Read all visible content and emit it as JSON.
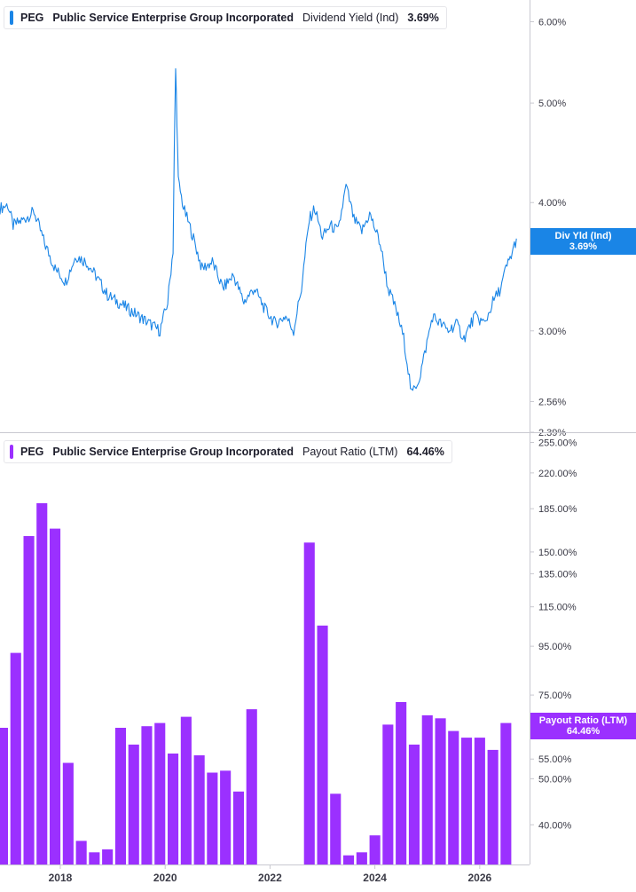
{
  "colors": {
    "yield": "#1a85e6",
    "payout": "#9b30ff",
    "axis": "#c9c9d0",
    "text": "#3a3a46"
  },
  "x_axis_ticks": [
    "2018",
    "2020",
    "2022",
    "2024",
    "2026"
  ],
  "panels": {
    "yield": {
      "ticker": "PEG",
      "company": "Public Service Enterprise Group Incorporated",
      "metric": "Dividend Yield (Ind)",
      "value": "3.69%",
      "badge_label": "Div Yld (Ind)",
      "badge_value": "3.69%"
    },
    "payout": {
      "ticker": "PEG",
      "company": "Public Service Enterprise Group Incorporated",
      "metric": "Payout Ratio (LTM)",
      "value": "64.46%",
      "badge_label": "Payout Ratio (LTM)",
      "badge_value": "64.46%"
    }
  },
  "chart_data": [
    {
      "type": "line",
      "series": [
        {
          "name": "Dividend Yield (Ind)"
        }
      ],
      "scale": "log",
      "ylim": [
        2.39,
        6.3
      ],
      "xlim": [
        2016.85,
        2026.95
      ],
      "y_tick_labels": [
        "6.00%",
        "5.00%",
        "4.00%",
        "3.00%",
        "2.56%",
        "2.39%"
      ],
      "y_ticks": [
        6.0,
        5.0,
        4.0,
        3.0,
        2.56,
        2.39
      ],
      "x": [
        2016.85,
        2017.0,
        2017.1,
        2017.3,
        2017.5,
        2017.7,
        2017.9,
        2018.1,
        2018.3,
        2018.5,
        2018.7,
        2018.9,
        2019.1,
        2019.3,
        2019.5,
        2019.7,
        2019.9,
        2020.05,
        2020.15,
        2020.2,
        2020.25,
        2020.35,
        2020.5,
        2020.7,
        2020.9,
        2021.1,
        2021.3,
        2021.5,
        2021.7,
        2021.9,
        2022.1,
        2022.3,
        2022.45,
        2022.6,
        2022.75,
        2022.85,
        2023.0,
        2023.15,
        2023.3,
        2023.45,
        2023.6,
        2023.75,
        2023.9,
        2024.1,
        2024.25,
        2024.4,
        2024.55,
        2024.7,
        2024.85,
        2024.95,
        2025.1,
        2025.25,
        2025.4,
        2025.55,
        2025.7,
        2025.9,
        2026.1,
        2026.25,
        2026.4,
        2026.5,
        2026.6,
        2026.7
      ],
      "values": [
        3.95,
        3.98,
        3.8,
        3.85,
        3.92,
        3.65,
        3.45,
        3.35,
        3.55,
        3.5,
        3.38,
        3.25,
        3.2,
        3.15,
        3.1,
        3.05,
        3.0,
        3.2,
        3.6,
        5.4,
        4.2,
        3.95,
        3.75,
        3.45,
        3.5,
        3.3,
        3.4,
        3.2,
        3.3,
        3.15,
        3.05,
        3.1,
        3.0,
        3.3,
        3.85,
        3.95,
        3.7,
        3.8,
        3.75,
        4.15,
        3.85,
        3.75,
        3.9,
        3.65,
        3.3,
        3.15,
        2.95,
        2.6,
        2.7,
        2.85,
        3.1,
        3.05,
        3.0,
        3.05,
        2.95,
        3.1,
        3.05,
        3.2,
        3.3,
        3.45,
        3.55,
        3.69
      ]
    },
    {
      "type": "bar",
      "series": [
        {
          "name": "Payout Ratio (LTM)"
        }
      ],
      "scale": "log",
      "ylim": [
        33,
        260
      ],
      "xlim": [
        2016.85,
        2026.95
      ],
      "y_tick_labels": [
        "255.00%",
        "220.00%",
        "185.00%",
        "150.00%",
        "135.00%",
        "115.00%",
        "95.00%",
        "75.00%",
        "55.00%",
        "50.00%",
        "40.00%"
      ],
      "y_ticks": [
        255,
        220,
        185,
        150,
        135,
        115,
        95,
        75,
        55,
        50,
        40
      ],
      "x": [
        2016.9,
        2017.15,
        2017.4,
        2017.65,
        2017.9,
        2018.15,
        2018.4,
        2018.65,
        2018.9,
        2019.15,
        2019.4,
        2019.65,
        2019.9,
        2020.15,
        2020.4,
        2020.65,
        2020.9,
        2021.15,
        2021.4,
        2021.65,
        2022.75,
        2023.0,
        2023.25,
        2023.5,
        2023.75,
        2024.0,
        2024.25,
        2024.5,
        2024.75,
        2025.0,
        2025.25,
        2025.5,
        2025.75,
        2026.0,
        2026.25,
        2026.5
      ],
      "values": [
        64,
        92,
        162,
        190,
        168,
        54,
        37,
        35,
        35.5,
        64,
        59,
        64.5,
        65.5,
        56.5,
        67.5,
        56,
        51.5,
        52,
        47,
        70,
        157,
        105,
        46.5,
        34.5,
        35,
        38,
        65,
        72.5,
        59,
        68,
        67,
        63,
        61,
        61,
        57.5,
        65.5
      ]
    }
  ]
}
